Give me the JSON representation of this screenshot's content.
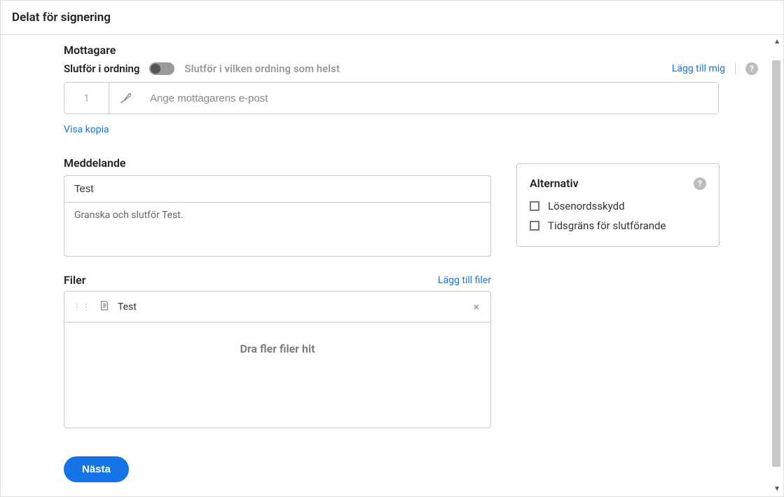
{
  "dialog": {
    "title": "Delat för signering"
  },
  "recipients": {
    "section_label": "Mottagare",
    "order_label": "Slutför i ordning",
    "order_hint": "Slutför i vilken ordning som helst",
    "add_me": "Lägg till mig",
    "row_number": "1",
    "email_placeholder": "Ange mottagarens e-post",
    "show_copy": "Visa kopia"
  },
  "message": {
    "section_label": "Meddelande",
    "subject": "Test",
    "body": "Granska och slutför Test."
  },
  "files": {
    "section_label": "Filer",
    "add_files": "Lägg till filer",
    "items": [
      {
        "name": "Test"
      }
    ],
    "drop_hint": "Dra fler filer hit"
  },
  "options": {
    "title": "Alternativ",
    "password_protect": "Lösenordsskydd",
    "completion_deadline": "Tidsgräns för slutförande"
  },
  "footer": {
    "next": "Nästa"
  },
  "icons": {
    "help": "?",
    "close": "×"
  }
}
